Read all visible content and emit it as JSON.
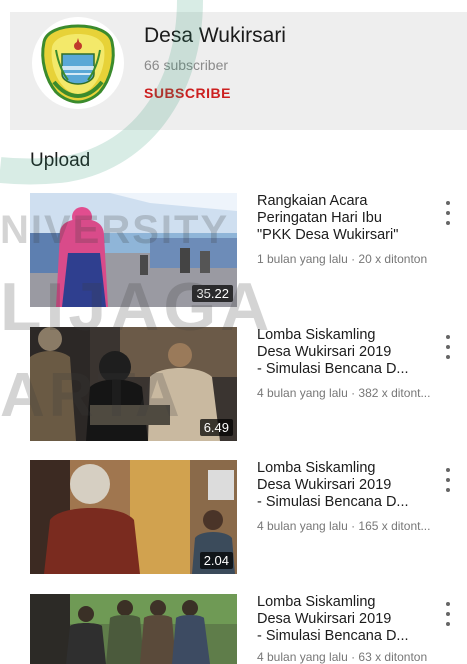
{
  "channel": {
    "name": "Desa Wukirsari",
    "subscribers": "66 subscriber",
    "subscribe_label": "SUBSCRIBE"
  },
  "section": {
    "title": "Upload"
  },
  "videos": [
    {
      "title_lines": [
        "Rangkaian Acara",
        "Peringatan Hari Ibu",
        "\"PKK Desa Wukirsari\""
      ],
      "meta": "1 bulan yang lalu · 20 x ditonton",
      "duration": "35.22"
    },
    {
      "title_lines": [
        "Lomba Siskamling",
        "Desa Wukirsari 2019",
        "- Simulasi Bencana D..."
      ],
      "meta": "4 bulan yang lalu · 382 x ditont...",
      "duration": "6.49"
    },
    {
      "title_lines": [
        "Lomba Siskamling",
        "Desa Wukirsari 2019",
        "- Simulasi Bencana D..."
      ],
      "meta": "4 bulan yang lalu · 165 x ditont...",
      "duration": "2.04"
    },
    {
      "title_lines": [
        "Lomba Siskamling",
        "Desa Wukirsari 2019",
        "- Simulasi Bencana D..."
      ],
      "meta": "4 bulan yang lalu · 63 x ditonton",
      "duration": ""
    }
  ],
  "watermark": {
    "line1": "NIVERSITY",
    "line2": "LIJAGA",
    "line3": "ARTA"
  },
  "colors": {
    "header_bg": "#eeeeee",
    "subscribe": "#cc1f1f",
    "meta_text": "#777777"
  },
  "icons": {
    "menu": "more-vert-icon",
    "logo": "village-emblem-icon"
  }
}
